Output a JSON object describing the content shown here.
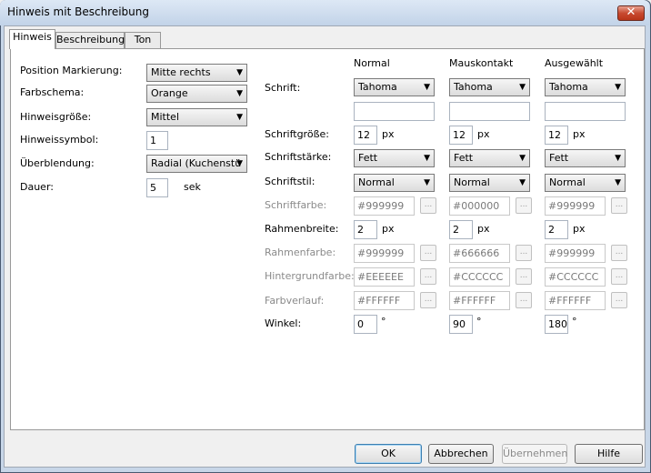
{
  "window": {
    "title": "Hinweis mit Beschreibung",
    "close_glyph": "✕"
  },
  "tabs": [
    {
      "label": "Hinweis"
    },
    {
      "label": "Beschreibung"
    },
    {
      "label": "Ton"
    }
  ],
  "left": {
    "position": {
      "label": "Position Markierung:",
      "value": "Mitte rechts"
    },
    "color_scheme": {
      "label": "Farbschema:",
      "value": "Orange"
    },
    "size": {
      "label": "Hinweisgröße:",
      "value": "Mittel"
    },
    "symbol": {
      "label": "Hinweissymbol:",
      "value": "1"
    },
    "transition": {
      "label": "Überblendung:",
      "value": "Radial (Kuchenstü"
    },
    "duration": {
      "label": "Dauer:",
      "value": "5",
      "unit": "sek"
    }
  },
  "columns": {
    "normal": "Normal",
    "hover": "Mauskontakt",
    "selected": "Ausgewählt"
  },
  "rows": {
    "font": {
      "label": "Schrift:",
      "values": [
        "Tahoma",
        "Tahoma",
        "Tahoma"
      ],
      "extra": [
        "",
        "",
        ""
      ]
    },
    "font_size": {
      "label": "Schriftgröße:",
      "values": [
        "12",
        "12",
        "12"
      ],
      "unit": "px"
    },
    "font_weight": {
      "label": "Schriftstärke:",
      "values": [
        "Fett",
        "Fett",
        "Fett"
      ]
    },
    "font_style": {
      "label": "Schriftstil:",
      "values": [
        "Normal",
        "Normal",
        "Normal"
      ]
    },
    "font_color": {
      "label": "Schriftfarbe:",
      "values": [
        "#999999",
        "#000000",
        "#999999"
      ]
    },
    "border_width": {
      "label": "Rahmenbreite:",
      "values": [
        "2",
        "2",
        "2"
      ],
      "unit": "px"
    },
    "border_color": {
      "label": "Rahmenfarbe:",
      "values": [
        "#999999",
        "#666666",
        "#999999"
      ]
    },
    "background_color": {
      "label": "Hintergrundfarbe:",
      "values": [
        "#EEEEEE",
        "#CCCCCC",
        "#CCCCCC"
      ]
    },
    "gradient": {
      "label": "Farbverlauf:",
      "values": [
        "#FFFFFF",
        "#FFFFFF",
        "#FFFFFF"
      ]
    },
    "angle": {
      "label": "Winkel:",
      "values": [
        "0",
        "90",
        "180"
      ],
      "unit": "°"
    }
  },
  "dots_label": "...",
  "dropdown_arrow": "▼",
  "buttons": {
    "ok": "OK",
    "cancel": "Abbrechen",
    "apply": "Übernehmen",
    "help": "Hilfe"
  }
}
